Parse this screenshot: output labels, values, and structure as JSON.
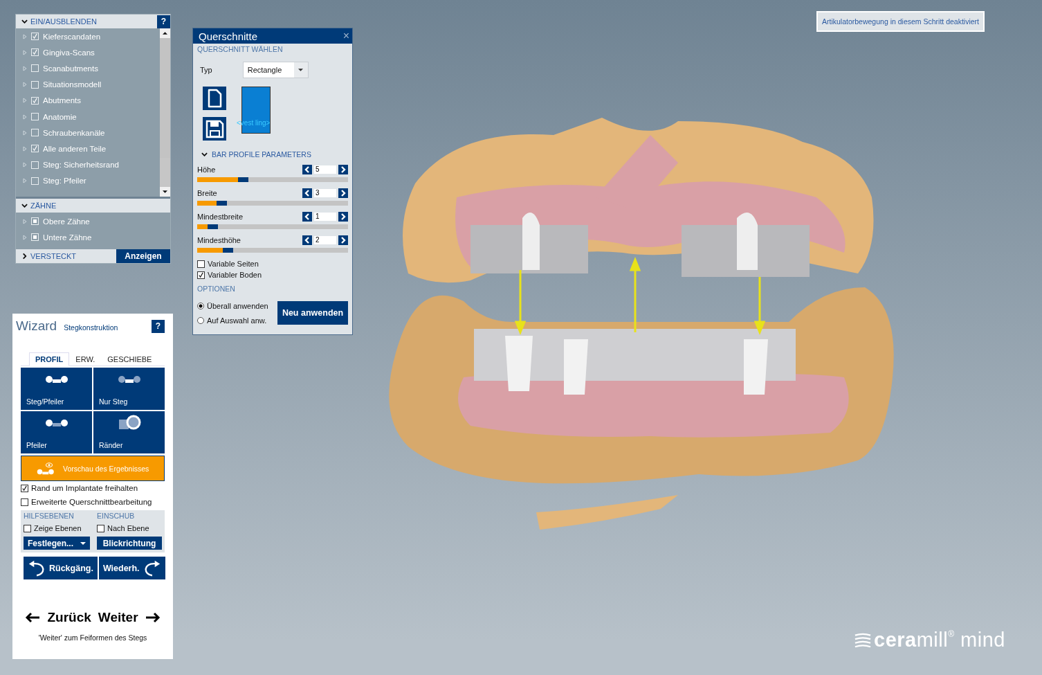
{
  "visibility_panel": {
    "title": "EIN/AUSBLENDEN",
    "help": "?",
    "items": [
      {
        "label": "Kieferscandaten",
        "checked": true
      },
      {
        "label": "Gingiva-Scans",
        "checked": true
      },
      {
        "label": "Scanabutments",
        "checked": false
      },
      {
        "label": "Situationsmodell",
        "checked": false
      },
      {
        "label": "Abutments",
        "checked": true
      },
      {
        "label": "Anatomie",
        "checked": false
      },
      {
        "label": "Schraubenkanäle",
        "checked": false
      },
      {
        "label": "Alle anderen Teile",
        "checked": true
      },
      {
        "label": "Steg: Sicherheitsrand",
        "checked": false
      },
      {
        "label": "Steg: Pfeiler",
        "checked": false
      }
    ],
    "teeth_section": {
      "title": "ZÄHNE",
      "expanded": true,
      "items": [
        {
          "label": "Obere Zähne",
          "indeterminate": true
        },
        {
          "label": "Untere Zähne",
          "indeterminate": true
        }
      ]
    },
    "hidden_section": {
      "title": "VERSTECKT",
      "expanded": false,
      "button": "Anzeigen"
    }
  },
  "cross_section_dialog": {
    "title": "Querschnitte",
    "close": "×",
    "section_title": "QUERSCHNITT WÄHLEN",
    "type_label": "Typ",
    "type_value": "Rectangle",
    "preview_label": "<vest ling>",
    "parameters_title": "BAR PROFILE PARAMETERS",
    "parameters": [
      {
        "label": "Höhe",
        "value": "5",
        "level": 0.27
      },
      {
        "label": "Breite",
        "value": "3",
        "level": 0.13
      },
      {
        "label": "Mindestbreite",
        "value": "1",
        "level": 0.07
      },
      {
        "label": "Mindesthöhe",
        "value": "2",
        "level": 0.17
      }
    ],
    "checkboxes": [
      {
        "label": "Variable Seiten",
        "checked": false
      },
      {
        "label": "Variabler Boden",
        "checked": true
      }
    ],
    "options_title": "OPTIONEN",
    "radios": [
      {
        "label": "Überall anwenden",
        "selected": true
      },
      {
        "label": "Auf Auswahl anw.",
        "selected": false
      }
    ],
    "apply_button": "Neu anwenden"
  },
  "wizard": {
    "title": "Wizard",
    "subtitle": "Stegkonstruktion",
    "help": "?",
    "tabs": [
      {
        "label": "PROFIL",
        "selected": true
      },
      {
        "label": "ERW.",
        "selected": false
      },
      {
        "label": "GESCHIEBE",
        "selected": false
      }
    ],
    "tiles": [
      {
        "label": "Steg/Pfeiler",
        "kind": "bar-pillar"
      },
      {
        "label": "Nur Steg",
        "kind": "bar-only"
      },
      {
        "label": "Pfeiler",
        "kind": "pillar"
      },
      {
        "label": "Ränder",
        "kind": "margins"
      }
    ],
    "preview_button": "Vorschau des Ergebnisses",
    "checkboxes": [
      {
        "label": "Rand um Implantate freihalten",
        "checked": true
      },
      {
        "label": "Erweiterte Querschnittbearbeitung",
        "checked": false
      }
    ],
    "helper_planes": {
      "title": "HILFSEBENEN",
      "checkbox": {
        "label": "Zeige Ebenen",
        "checked": false
      },
      "button": "Festlegen..."
    },
    "insertion": {
      "title": "EINSCHUB",
      "checkbox": {
        "label": "Nach Ebene",
        "checked": false
      },
      "button": "Blickrichtung"
    },
    "undo": "Rückgäng.",
    "redo": "Wiederh.",
    "back": "Zurück",
    "next": "Weiter",
    "hint": "'Weiter' zum Feiformen des Stegs"
  },
  "notice": "Artikulatorbewegung in diesem Schritt deaktiviert",
  "logo": "**cera**mill$^{®}$ mind"
}
